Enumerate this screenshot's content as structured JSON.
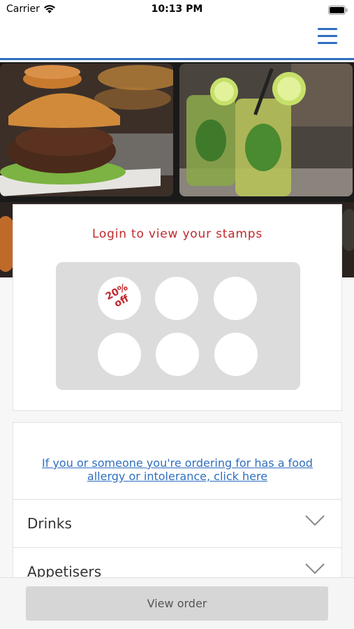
{
  "status_bar": {
    "carrier": "Carrier",
    "time": "10:13 PM",
    "icons": [
      "wifi-icon",
      "battery-icon"
    ]
  },
  "nav": {
    "menu_icon": "hamburger-menu-icon",
    "accent_color": "#2f6fc0"
  },
  "hero": {
    "images": [
      "burger-photo",
      "mojito-drinks-photo",
      "food-strip-photo"
    ]
  },
  "stamps": {
    "title": "Login to view your stamps",
    "title_color": "#c0282d",
    "reward_label_line1": "20%",
    "reward_label_line2": "off",
    "total": 6
  },
  "allergy": {
    "link_text": "If you or someone you're ordering for has a food allergy or intolerance, click here"
  },
  "categories": [
    {
      "label": "Drinks"
    },
    {
      "label": "Appetisers"
    }
  ],
  "footer": {
    "view_order_label": "View order"
  }
}
